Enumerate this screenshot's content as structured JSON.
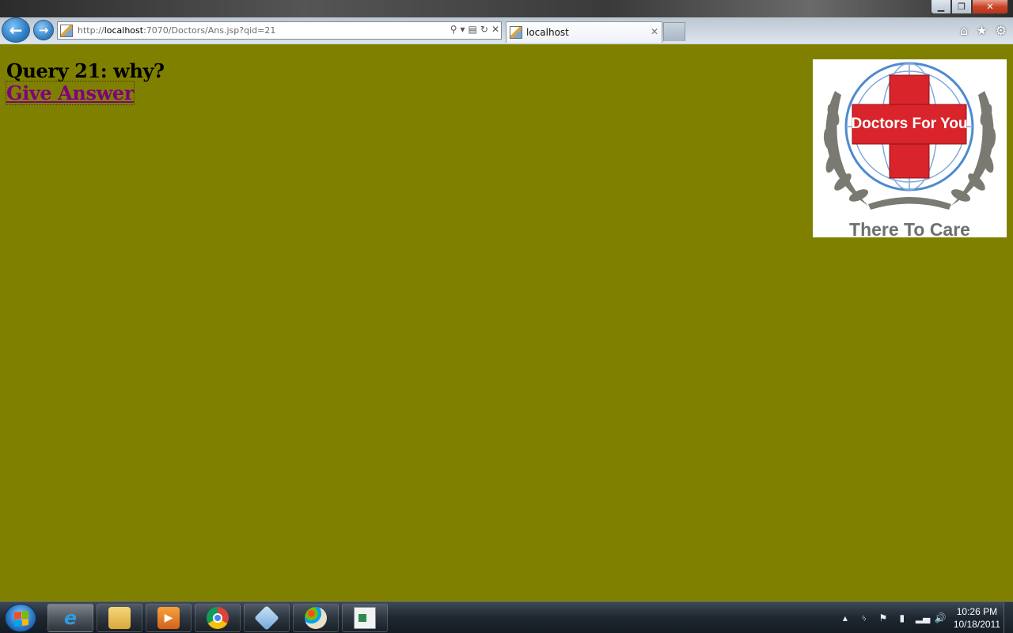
{
  "browser": {
    "url_prefix": "http://",
    "url_host": "localhost",
    "url_rest": ":7070/Doctors/Ans.jsp?qid=21",
    "tab_title": "localhost",
    "window_close": "✕",
    "window_min": "▁",
    "window_restore": "❐"
  },
  "page": {
    "query_text": "Query 21: why?",
    "answer_link": "Give Answer",
    "background_color": "#808000",
    "link_color": "#800080"
  },
  "logo": {
    "banner_text": "Doctors For You",
    "caption": "There To Care"
  },
  "taskbar": {
    "time": "10:26 PM",
    "date": "10/18/2011",
    "items": [
      "internet-explorer",
      "file-explorer",
      "media-player",
      "chrome",
      "virtualbox",
      "paint",
      "application-window"
    ]
  }
}
